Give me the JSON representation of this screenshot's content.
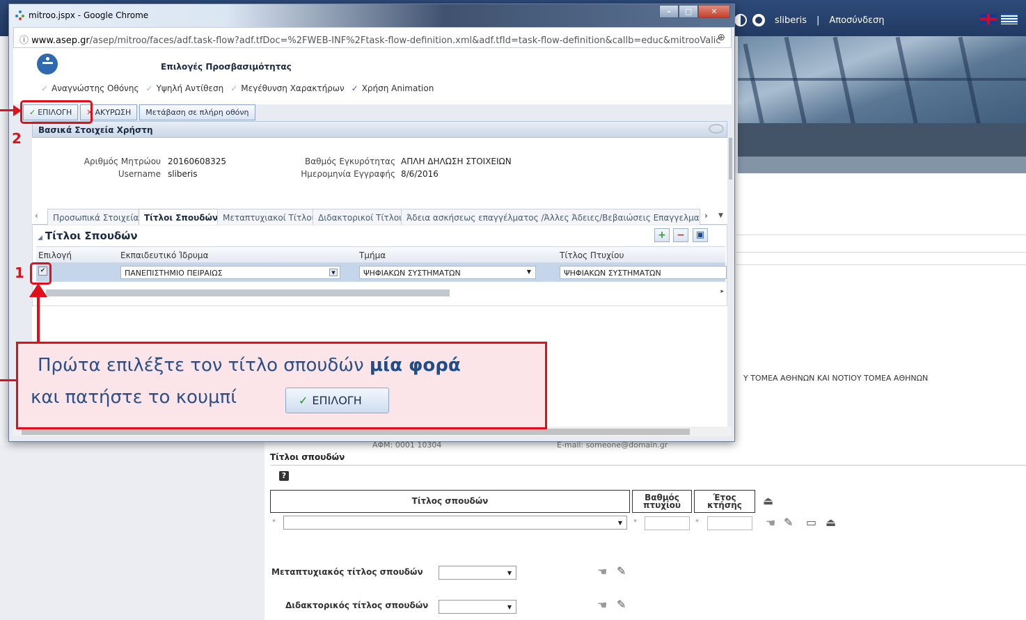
{
  "background": {
    "user": "sliberis",
    "logout": "Αποσύνδεση",
    "separator": "|",
    "region_text": "Υ ΤΟΜΕΑ ΑΘΗΝΩΝ ΚΑΙ ΝΟΤΙΟΥ ΤΟΜΕΑ ΑΘΗΝΩΝ",
    "afm_partial": "ΑΦΜ: 0001 10304",
    "email_partial": "E-mail: someone@domain.gr",
    "section_title": "Τίτλοι σπουδών",
    "col_title": "Τίτλος σπουδών",
    "col_grade": "Βαθμός πτυχίου",
    "col_year": "Έτος κτήσης",
    "postgrad_label": "Μεταπτυχιακός τίτλος σπουδών",
    "doctoral_label": "Διδακτορικός τίτλος σπουδών",
    "required_mark": "*"
  },
  "window": {
    "title": "mitroo.jspx - Google Chrome",
    "url_host": "www.asep.gr",
    "url_path": "/asep/mitroo/faces/adf.task-flow?adf.tfDoc=%2FWEB-INF%2Ftask-flow-definition.xml&adf.tfId=task-flow-definition&callb=educ&mitrooValic"
  },
  "accessibility": {
    "title": "Επιλογές Προσβασιμότητας",
    "options": [
      {
        "label": "Αναγνώστης Οθόνης",
        "checked": false
      },
      {
        "label": "Υψηλή Αντίθεση",
        "checked": false
      },
      {
        "label": "Μεγέθυνση Χαρακτήρων",
        "checked": false
      },
      {
        "label": "Χρήση Animation",
        "checked": true
      }
    ]
  },
  "toolbar": {
    "select_label": "ΕΠΙΛΟΓΗ",
    "cancel_label": "ΑΚΥΡΩΣΗ",
    "fullscreen_label": "Μετάβαση σε πλήρη οθόνη"
  },
  "user_info": {
    "panel_title": "Βασικά Στοιχεία Χρήστη",
    "registry_label": "Αριθμός Μητρώου",
    "registry_value": "20160608325",
    "username_label": "Username",
    "username_value": "sliberis",
    "validity_label": "Βαθμός Εγκυρότητας",
    "validity_value": "ΑΠΛΗ ΔΗΛΩΣΗ ΣΤΟΙΧΕΙΩΝ",
    "reg_date_label": "Ημερομηνία Εγγραφής",
    "reg_date_value": "8/6/2016"
  },
  "tabs": [
    {
      "label": "Προσωπικά Στοιχεία",
      "active": false
    },
    {
      "label": "Τίτλοι Σπουδών",
      "active": true
    },
    {
      "label": "Μεταπτυχιακοί Τίτλοι",
      "active": false
    },
    {
      "label": "Διδακτορικοί Τίτλοι",
      "active": false
    },
    {
      "label": "Άδεια ασκήσεως επαγγέλματος /Άλλες Άδειες/Βεβαιώσεις Επαγγελματικών Ι",
      "active": false
    }
  ],
  "grid": {
    "title": "Τίτλοι Σπουδών",
    "columns": [
      "Επιλογή",
      "Εκπαιδευτικό Ίδρυμα",
      "Τμήμα",
      "Τίτλος Πτυχίου"
    ],
    "row": {
      "selected": true,
      "institution": "ΠΑΝΕΠΙΣΤΗΜΙΟ ΠΕΙΡΑΙΩΣ",
      "department": "ΨΗΦΙΑΚΩΝ ΣΥΣΤΗΜΑΤΩΝ",
      "degree": "ΨΗΦΙΑΚΩΝ ΣΥΣΤΗΜΑΤΩΝ"
    }
  },
  "annotation": {
    "step1": "1",
    "step2": "2",
    "line1_pre": "Πρώτα επιλέξτε τον τίτλο σπουδών ",
    "line1_bold": "μία φορά",
    "line2": "και πατήστε το κουμπί",
    "button_label": "ΕΠΙΛΟΓΗ"
  },
  "colors": {
    "highlight": "#e0101a",
    "callout_bg": "#fbe5e8",
    "callout_text": "#2b4f86"
  }
}
